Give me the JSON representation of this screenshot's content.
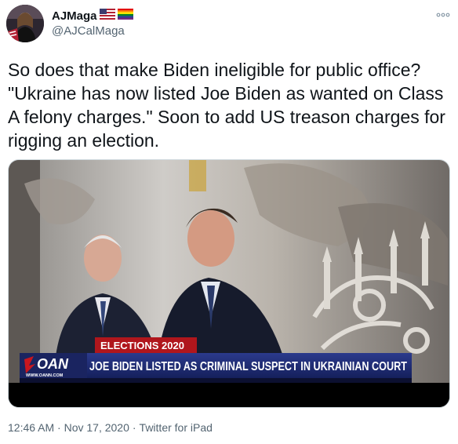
{
  "tweet": {
    "display_name": "AJMaga",
    "handle": "@AJCalMaga",
    "text": "So does that make Biden ineligible for public office?\n\"Ukraine has now listed Joe Biden as wanted on Class A felony charges.\" Soon to add US treason charges for rigging an election.",
    "timestamp": "12:46 AM · Nov 17, 2020",
    "source": "Twitter for iPad"
  },
  "icons": {
    "flags": [
      "us-flag-icon",
      "rainbow-flag-icon"
    ],
    "more": "more-options-icon"
  },
  "media": {
    "banner_top": "ELECTIONS 2020",
    "channel_logo": "OAN",
    "channel_url": "WWW.OANN.COM",
    "headline": "JOE BIDEN LISTED AS CRIMINAL SUSPECT IN UKRAINIAN COURT"
  },
  "colors": {
    "banner_red": "#b0161c",
    "banner_blue": "#1d2a6e",
    "oan_red": "#c8161e"
  }
}
